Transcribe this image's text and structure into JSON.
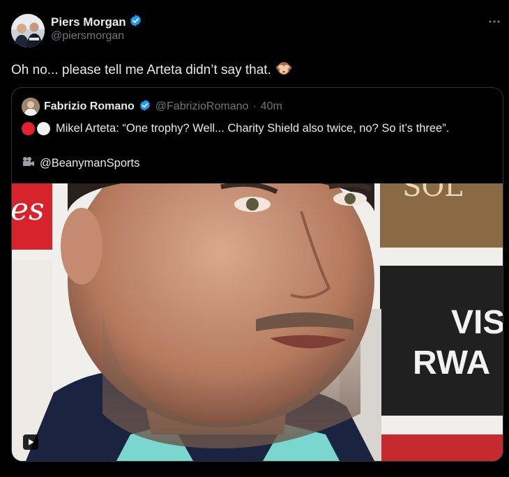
{
  "author": {
    "display_name": "Piers Morgan",
    "handle": "@piersmorgan",
    "verified_color": "#1d9bf0"
  },
  "tweet": {
    "text": "Oh no... please tell me Arteta didn’t say that.",
    "emoji": "see-no-evil-monkey"
  },
  "more_icon": "more-horizontal-icon",
  "quoted_tweet": {
    "display_name": "Fabrizio Romano",
    "handle": "@FabrizioRomano",
    "separator": "·",
    "time": "40m",
    "text": "Mikel Arteta: “One trophy? Well... Charity Shield also twice, no? So it’s three”.",
    "credit": "@BeanymanSports",
    "credit_icon": "video-camera-icon",
    "media": {
      "type": "video-thumbnail",
      "background_texts": [
        "es",
        "SOL",
        "VIS",
        "RWA"
      ]
    }
  },
  "colors": {
    "background": "#000000",
    "text": "#e7e9ea",
    "muted": "#71767b",
    "border": "#2f3336",
    "verified": "#1d9bf0"
  }
}
